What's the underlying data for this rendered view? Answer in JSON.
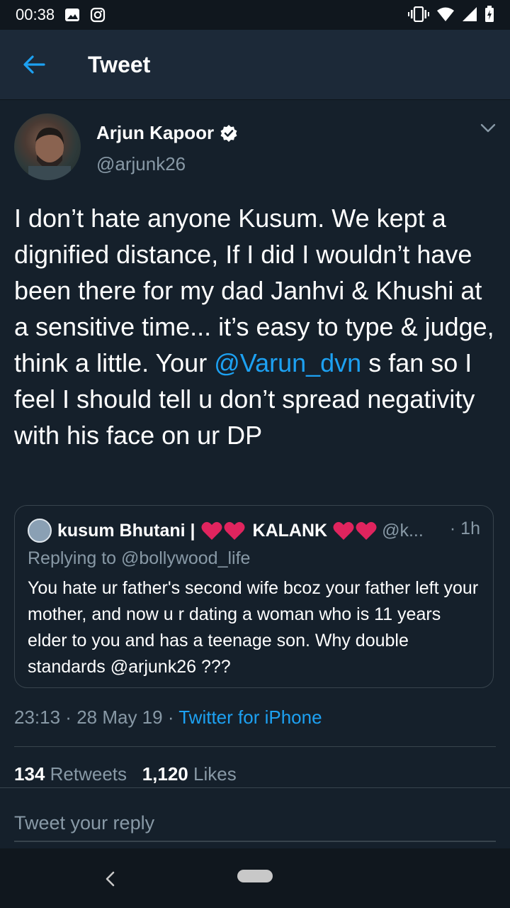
{
  "status_bar": {
    "time": "00:38",
    "icons": [
      "image-icon",
      "instagram-icon",
      "vibrate-icon",
      "wifi-icon",
      "signal-icon",
      "battery-icon"
    ]
  },
  "app_bar": {
    "title": "Tweet",
    "back_icon": "back-arrow-icon"
  },
  "tweet": {
    "author_name": "Arjun Kapoor",
    "author_handle": "@arjunk26",
    "text_before_mention": "I don’t hate anyone Kusum. We kept a dignified distance, If I did I wouldn’t have been there for my dad Janhvi & Khushi at a sensitive time... it’s easy to type & judge, think a little. Your ",
    "mention": "@Varun_dvn",
    "text_after_mention": " s fan so I feel I should tell u don’t spread negativity with his face on ur DP",
    "time": "23:13",
    "date": "28 May 19",
    "source": "Twitter for iPhone",
    "retweets_count": "134",
    "retweets_label": "Retweets",
    "likes_count": "1,120",
    "likes_label": "Likes"
  },
  "quoted_tweet": {
    "name_part1": "kusum Bhutani |",
    "name_part2": "KALANK",
    "handle": "@k...",
    "time": "· 1h",
    "replying_to": "Replying to @bollywood_life",
    "text": "You hate ur father's second wife bcoz your father left your mother, and now u r dating a woman who is 11 years elder to you and has a teenage son. Why double standards @arjunk26 ???"
  },
  "reply": {
    "placeholder": "Tweet your reply"
  },
  "colors": {
    "background": "#15202b",
    "appbar": "#1c2938",
    "accent": "#1da1f2",
    "muted": "#8899a6",
    "heart": "#e0245e"
  }
}
